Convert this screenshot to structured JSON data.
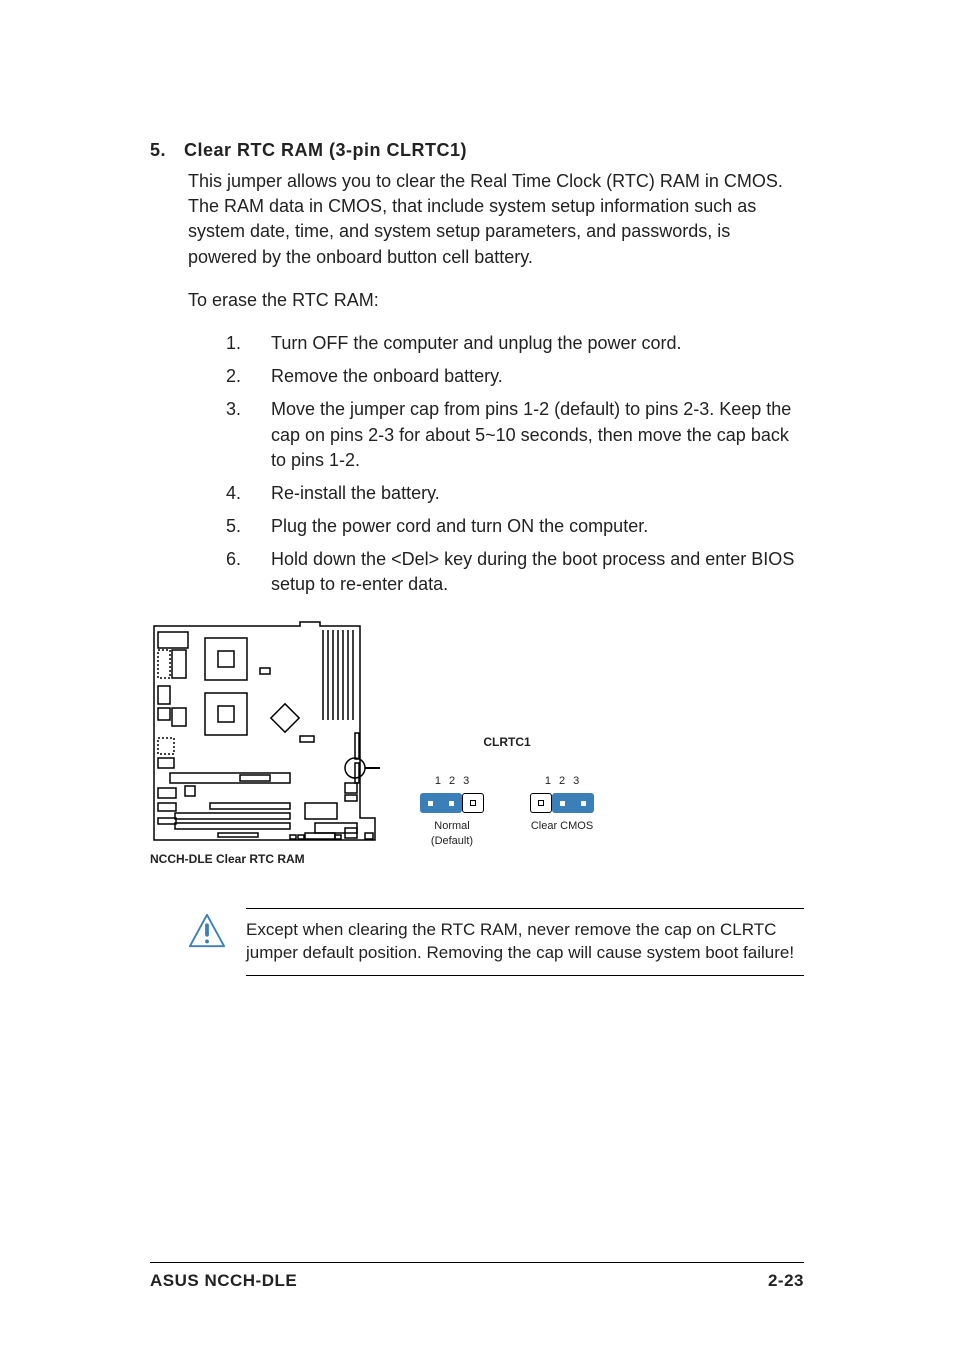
{
  "heading": {
    "num": "5.",
    "title": "Clear RTC RAM (3-pin CLRTC1)"
  },
  "para1": "This jumper allows you to clear the  Real Time Clock (RTC) RAM in CMOS. The RAM data in CMOS, that include system setup information such as system date, time, and system setup parameters, and passwords, is powered by the onboard button cell battery.",
  "para2": "To erase the RTC RAM:",
  "steps": [
    {
      "num": "1.",
      "text": "Turn OFF the computer and unplug the power cord."
    },
    {
      "num": "2.",
      "text": "Remove the onboard battery."
    },
    {
      "num": "3.",
      "text": "Move the jumper cap from pins 1-2 (default) to pins 2-3. Keep the cap on pins 2-3 for about 5~10 seconds, then move the cap back to pins 1-2."
    },
    {
      "num": "4.",
      "text": "Re-install the battery."
    },
    {
      "num": "5.",
      "text": "Plug the power cord and turn ON the computer."
    },
    {
      "num": "6.",
      "text": "Hold down the <Del> key during the boot process and enter BIOS setup to re-enter data."
    }
  ],
  "diagram": {
    "caption": "NCCH-DLE Clear RTC RAM",
    "jumper_label": "CLRTC1",
    "normal": {
      "pin_labels": [
        "1",
        "2",
        "3"
      ],
      "line1": "Normal",
      "line2": "(Default)"
    },
    "clear": {
      "pin_labels": [
        "1",
        "2",
        "3"
      ],
      "line1": "Clear CMOS"
    }
  },
  "note": "Except when clearing the RTC RAM, never remove the cap on CLRTC jumper default position. Removing the cap will cause system boot failure!",
  "footer": {
    "left": "ASUS NCCH-DLE",
    "right": "2-23"
  }
}
